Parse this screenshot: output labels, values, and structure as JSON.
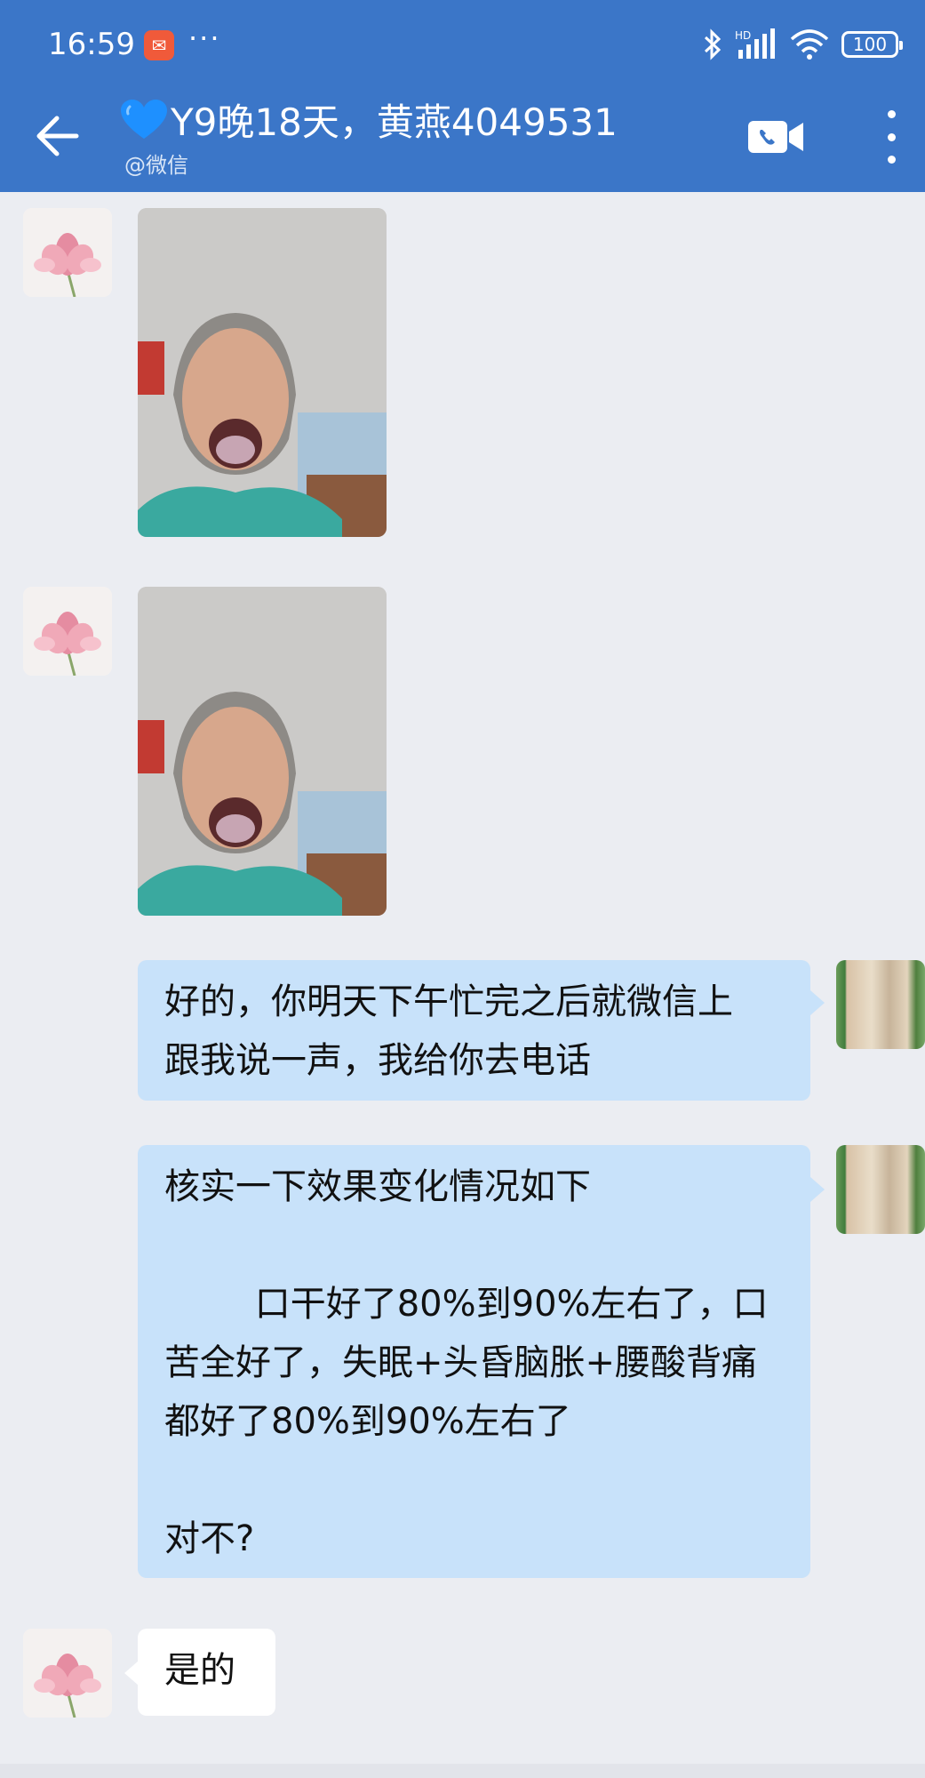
{
  "status_bar": {
    "time": "16:59",
    "more": "···",
    "network": "HD",
    "battery": "100"
  },
  "header": {
    "title": "Y9晚18天，黄燕4049531",
    "subtitle": "@微信",
    "colors": {
      "bar": "#3b76c8",
      "heart": "#1e90ff"
    }
  },
  "messages": [
    {
      "side": "in",
      "type": "image",
      "alt": "photo"
    },
    {
      "side": "in",
      "type": "image",
      "alt": "photo"
    },
    {
      "side": "out",
      "type": "text",
      "lines": [
        "好的，你明天下午忙完之后就微信上",
        "跟我说一声，我给你去电话"
      ]
    },
    {
      "side": "out",
      "type": "text",
      "lines": [
        "核实一下效果变化情况如下",
        "",
        "        口干好了80%到90%左右了，口",
        "苦全好了，失眠+头昏脑胀+腰酸背痛",
        "都好了80%到90%左右了",
        "",
        "对不?"
      ]
    },
    {
      "side": "in",
      "type": "text",
      "lines": [
        "是的"
      ]
    }
  ],
  "colors": {
    "outgoing_bubble": "#c8e2fa",
    "incoming_bubble": "#ffffff",
    "background": "#ebedf2"
  }
}
